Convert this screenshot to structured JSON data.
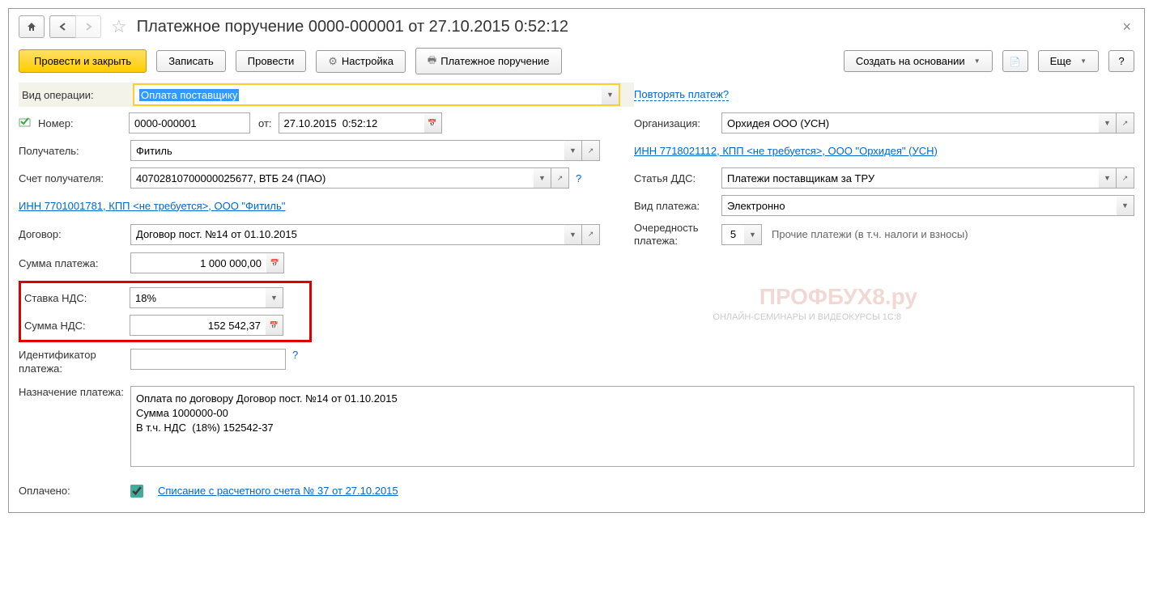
{
  "header": {
    "title": "Платежное поручение 0000-000001 от 27.10.2015 0:52:12"
  },
  "toolbar": {
    "post_close": "Провести и закрыть",
    "save": "Записать",
    "post": "Провести",
    "settings": "Настройка",
    "print": "Платежное поручение",
    "create_based": "Создать на основании",
    "more": "Еще",
    "help": "?"
  },
  "labels": {
    "operation_type": "Вид операции:",
    "number": "Номер:",
    "from": "от:",
    "recipient": "Получатель:",
    "recipient_account": "Счет получателя:",
    "contract": "Договор:",
    "payment_sum": "Сумма платежа:",
    "vat_rate": "Ставка НДС:",
    "vat_sum": "Сумма НДС:",
    "payment_id": "Идентификатор платежа:",
    "payment_purpose": "Назначение платежа:",
    "paid": "Оплачено:",
    "organization": "Организация:",
    "dds": "Статья ДДС:",
    "payment_type": "Вид платежа:",
    "priority": "Очередность платежа:"
  },
  "values": {
    "operation_type": "Оплата поставщику",
    "number": "0000-000001",
    "date": "27.10.2015  0:52:12",
    "recipient": "Фитиль",
    "recipient_account": "40702810700000025677, ВТБ 24 (ПАО)",
    "contract": "Договор пост. №14 от 01.10.2015",
    "payment_sum": "1 000 000,00",
    "vat_rate": "18%",
    "vat_sum": "152 542,37",
    "payment_id": "",
    "payment_purpose": "Оплата по договору Договор пост. №14 от 01.10.2015\nСумма 1000000-00\nВ т.ч. НДС  (18%) 152542-37",
    "organization": "Орхидея ООО (УСН)",
    "dds": "Платежи поставщикам за ТРУ",
    "payment_type": "Электронно",
    "priority": "5",
    "priority_text": "Прочие платежи (в т.ч. налоги и взносы)"
  },
  "links": {
    "repeat_payment": "Повторять платеж?",
    "org_info": "ИНН 7718021112, КПП <не требуется>, ООО \"Орхидея\" (УСН)",
    "recipient_info": "ИНН 7701001781, КПП <не требуется>, ООО \"Фитиль\"",
    "writeoff": "Списание с расчетного счета № 37 от 27.10.2015"
  },
  "watermark": {
    "main": "ПРОФБУХ8.ру",
    "sub": "ОНЛАЙН-СЕМИНАРЫ И ВИДЕОКУРСЫ 1С:8"
  }
}
